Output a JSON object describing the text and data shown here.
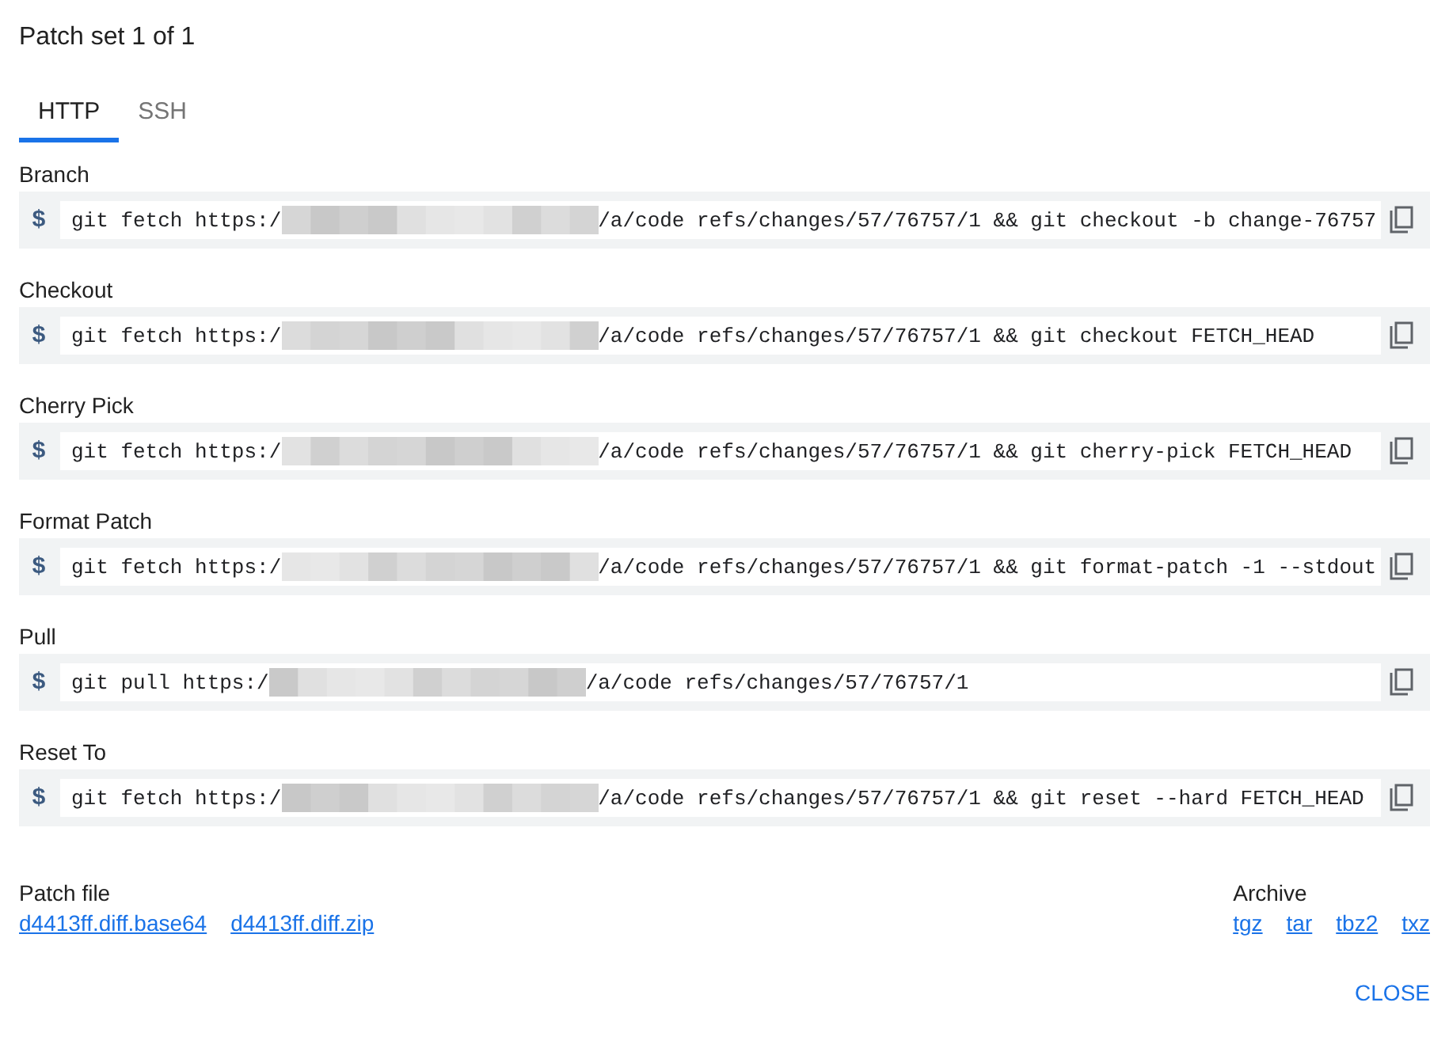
{
  "title": "Patch set 1 of 1",
  "tabs": [
    {
      "label": "HTTP",
      "selected": true
    },
    {
      "label": "SSH",
      "selected": false
    }
  ],
  "commands": [
    {
      "label": "Branch",
      "prompt": "$",
      "prefix": "git fetch https:/",
      "suffix": "/a/code refs/changes/57/76757/1 && git checkout -b change-76757"
    },
    {
      "label": "Checkout",
      "prompt": "$",
      "prefix": "git fetch https:/",
      "suffix": "/a/code refs/changes/57/76757/1 && git checkout FETCH_HEAD"
    },
    {
      "label": "Cherry Pick",
      "prompt": "$",
      "prefix": "git fetch https:/",
      "suffix": "/a/code refs/changes/57/76757/1 && git cherry-pick FETCH_HEAD"
    },
    {
      "label": "Format Patch",
      "prompt": "$",
      "prefix": "git fetch https:/",
      "suffix": "/a/code refs/changes/57/76757/1 && git format-patch -1 --stdout"
    },
    {
      "label": "Pull",
      "prompt": "$",
      "prefix": "git pull https:/",
      "suffix": "/a/code refs/changes/57/76757/1"
    },
    {
      "label": "Reset To",
      "prompt": "$",
      "prefix": "git fetch https:/",
      "suffix": "/a/code refs/changes/57/76757/1 && git reset --hard FETCH_HEAD"
    }
  ],
  "patch_file": {
    "label": "Patch file",
    "links": [
      "d4413ff.diff.base64",
      "d4413ff.diff.zip"
    ]
  },
  "archive": {
    "label": "Archive",
    "links": [
      "tgz",
      "tar",
      "tbz2",
      "txz"
    ]
  },
  "close_button": "CLOSE"
}
